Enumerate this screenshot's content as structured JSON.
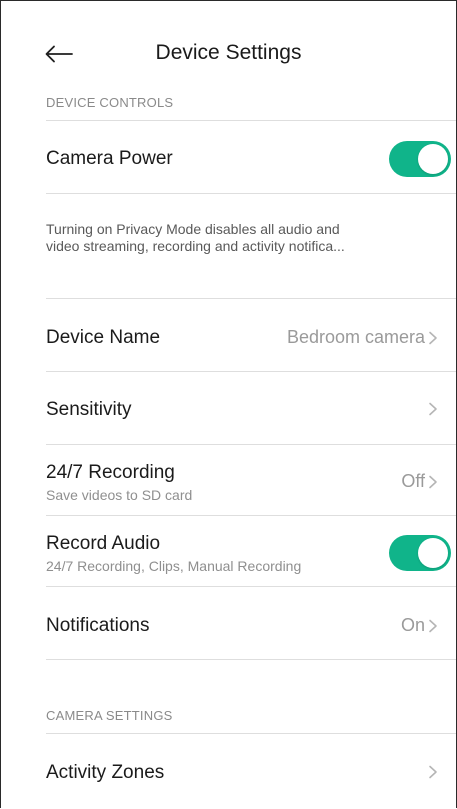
{
  "header": {
    "title": "Device Settings",
    "back_icon": "arrow-left-icon"
  },
  "sections": {
    "device_controls": "DEVICE CONTROLS",
    "camera_settings": "CAMERA SETTINGS"
  },
  "camera_power": {
    "label": "Camera Power",
    "enabled": true
  },
  "privacy_description": {
    "line1": "Turning on Privacy Mode disables all audio and",
    "line2": "video streaming, recording and activity notifica..."
  },
  "device_name": {
    "label": "Device Name",
    "value": "Bedroom camera"
  },
  "sensitivity": {
    "label": "Sensitivity"
  },
  "recording_247": {
    "label": "24/7 Recording",
    "sublabel": "Save videos to SD card",
    "value": "Off"
  },
  "record_audio": {
    "label": "Record Audio",
    "sublabel": "24/7 Recording, Clips, Manual Recording",
    "enabled": true
  },
  "notifications": {
    "label": "Notifications",
    "value": "On"
  },
  "activity_zones": {
    "label": "Activity Zones"
  },
  "colors": {
    "toggle_on": "#10b48a",
    "chevron": "#b5b5b5"
  }
}
